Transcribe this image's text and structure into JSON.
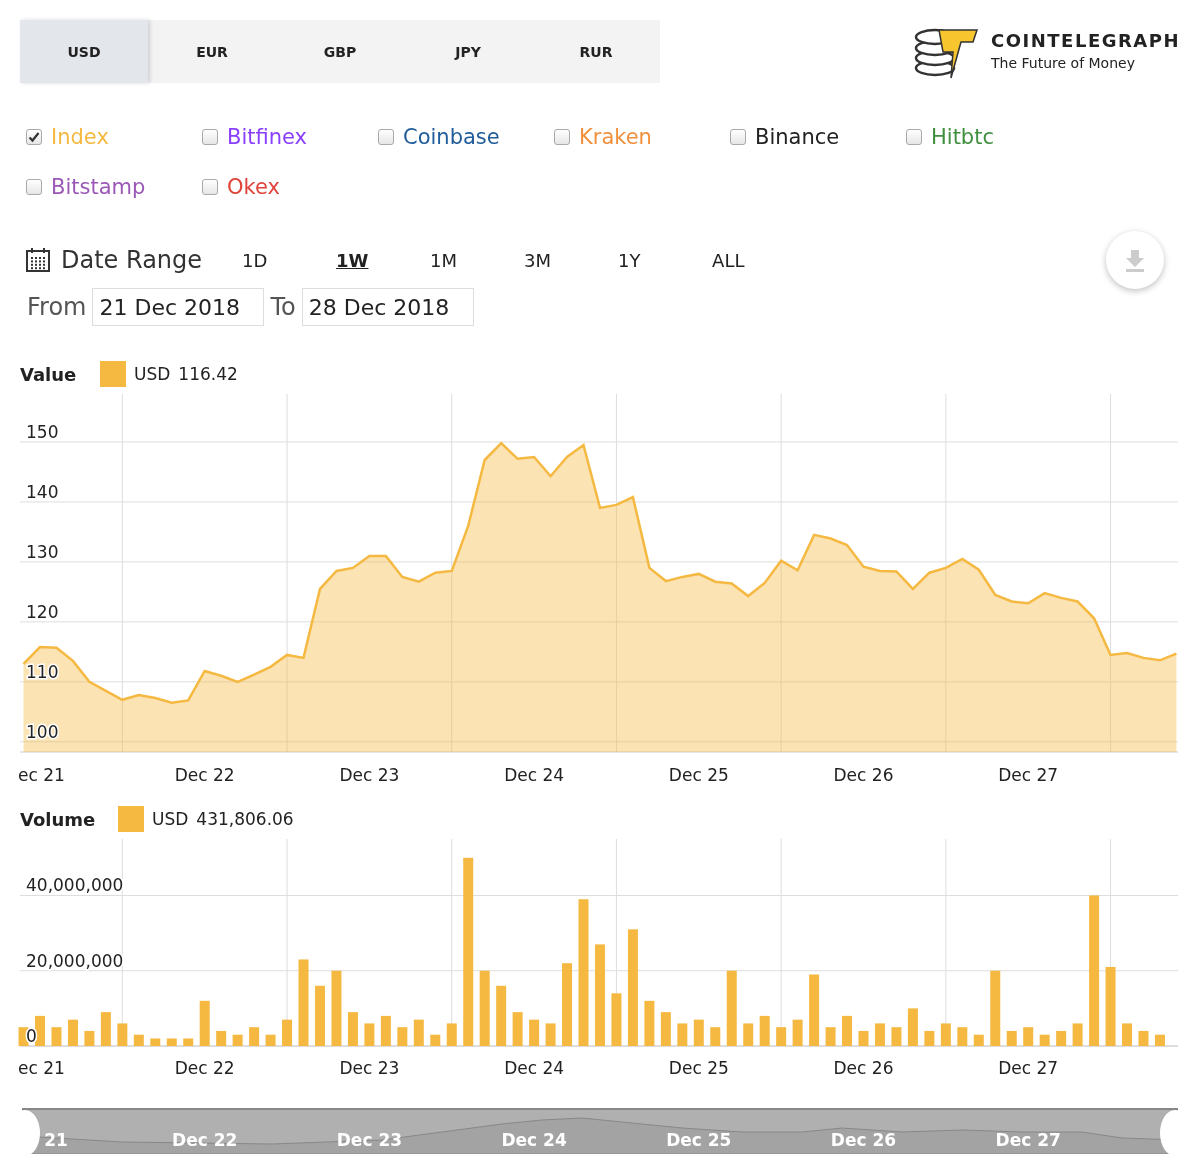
{
  "currency_tabs": [
    {
      "label": "USD",
      "selected": true
    },
    {
      "label": "EUR",
      "selected": false
    },
    {
      "label": "GBP",
      "selected": false
    },
    {
      "label": "JPY",
      "selected": false
    },
    {
      "label": "RUR",
      "selected": false
    }
  ],
  "logo": {
    "name": "COINTELEGRAPH",
    "tagline": "The Future of Money"
  },
  "exchanges": [
    {
      "label": "Index",
      "checked": true,
      "color": "#f5b942"
    },
    {
      "label": "Bitfinex",
      "checked": false,
      "color": "#8a3ffc"
    },
    {
      "label": "Coinbase",
      "checked": false,
      "color": "#1f5c99"
    },
    {
      "label": "Kraken",
      "checked": false,
      "color": "#f0903c"
    },
    {
      "label": "Binance",
      "checked": false,
      "color": "#222222"
    },
    {
      "label": "Hitbtc",
      "checked": false,
      "color": "#3f8f3f"
    },
    {
      "label": "Bitstamp",
      "checked": false,
      "color": "#9b59b6"
    },
    {
      "label": "Okex",
      "checked": false,
      "color": "#e0433a"
    }
  ],
  "date_range": {
    "label": "Date Range",
    "options": [
      {
        "label": "1D",
        "selected": false
      },
      {
        "label": "1W",
        "selected": true
      },
      {
        "label": "1M",
        "selected": false
      },
      {
        "label": "3M",
        "selected": false
      },
      {
        "label": "1Y",
        "selected": false
      },
      {
        "label": "ALL",
        "selected": false
      }
    ],
    "from_label": "From",
    "from": "21 Dec 2018",
    "to_label": "To",
    "to": "28 Dec 2018"
  },
  "value_chart": {
    "title": "Value",
    "legend": {
      "currency": "USD",
      "reading": "116.42"
    },
    "chart_data": {
      "type": "area",
      "grid": true,
      "ylim": [
        98.3,
        158
      ],
      "yticks": [
        100,
        110,
        120,
        130,
        140,
        150
      ],
      "categories": [
        null,
        "ec 21",
        null,
        null,
        null,
        null,
        null,
        null,
        null,
        null,
        null,
        "Dec 22",
        null,
        null,
        null,
        null,
        null,
        null,
        null,
        null,
        null,
        "Dec 23",
        null,
        null,
        null,
        null,
        null,
        null,
        null,
        null,
        null,
        "Dec 24",
        null,
        null,
        null,
        null,
        null,
        null,
        null,
        null,
        null,
        "Dec 25",
        null,
        null,
        null,
        null,
        null,
        null,
        null,
        null,
        null,
        "Dec 26",
        null,
        null,
        null,
        null,
        null,
        null,
        null,
        null,
        null,
        "Dec 27",
        null,
        null,
        null,
        null,
        null,
        null,
        null,
        null,
        null
      ],
      "series": [
        {
          "color": "#f5b942",
          "values": [
            113,
            115.8,
            115.7,
            113.5,
            110,
            108.5,
            107,
            107.8,
            107.3,
            106.5,
            106.9,
            111.8,
            111,
            110,
            111.2,
            112.5,
            114.5,
            114,
            125.5,
            128.5,
            129,
            131,
            131,
            127.5,
            126.7,
            128.2,
            128.5,
            136,
            147,
            149.8,
            147.2,
            147.5,
            144.3,
            147.5,
            149.5,
            139,
            139.5,
            140.8,
            129,
            126.8,
            127.5,
            128,
            126.7,
            126.4,
            124.3,
            126.5,
            130.2,
            128.6,
            134.5,
            133.9,
            132.8,
            129.2,
            128.5,
            128.4,
            125.5,
            128.2,
            129,
            130.5,
            128.7,
            124.5,
            123.4,
            123.1,
            124.8,
            124,
            123.4,
            120.6,
            114.5,
            114.8,
            114,
            113.6,
            114.7
          ]
        }
      ]
    }
  },
  "volume_chart": {
    "title": "Volume",
    "legend": {
      "currency": "USD",
      "reading": "431,806.06"
    },
    "chart_data": {
      "type": "bar",
      "grid": true,
      "ylim": [
        0,
        55000000
      ],
      "yticks": [
        {
          "value": 0,
          "label": "0"
        },
        {
          "value": 20000000,
          "label": "20,000,000"
        },
        {
          "value": 40000000,
          "label": "40,000,000"
        }
      ],
      "categories": [
        null,
        "ec 21",
        null,
        null,
        null,
        null,
        null,
        null,
        null,
        null,
        null,
        "Dec 22",
        null,
        null,
        null,
        null,
        null,
        null,
        null,
        null,
        null,
        "Dec 23",
        null,
        null,
        null,
        null,
        null,
        null,
        null,
        null,
        null,
        "Dec 24",
        null,
        null,
        null,
        null,
        null,
        null,
        null,
        null,
        null,
        "Dec 25",
        null,
        null,
        null,
        null,
        null,
        null,
        null,
        null,
        null,
        "Dec 26",
        null,
        null,
        null,
        null,
        null,
        null,
        null,
        null,
        null,
        "Dec 27",
        null,
        null,
        null,
        null,
        null,
        null,
        null,
        null
      ],
      "series": [
        {
          "color": "#f5b942",
          "values": [
            5000000,
            8000000,
            5000000,
            7000000,
            4000000,
            9000000,
            6000000,
            3000000,
            2000000,
            2000000,
            2000000,
            12000000,
            4000000,
            3000000,
            5000000,
            3000000,
            7000000,
            23000000,
            16000000,
            20000000,
            9000000,
            6000000,
            8000000,
            5000000,
            7000000,
            3000000,
            6000000,
            50000000,
            20000000,
            16000000,
            9000000,
            7000000,
            6000000,
            22000000,
            39000000,
            27000000,
            14000000,
            31000000,
            12000000,
            9000000,
            6000000,
            7000000,
            5000000,
            20000000,
            6000000,
            8000000,
            5000000,
            7000000,
            19000000,
            5000000,
            8000000,
            4000000,
            6000000,
            5000000,
            10000000,
            4000000,
            6000000,
            5000000,
            3000000,
            20000000,
            4000000,
            5000000,
            3000000,
            4000000,
            6000000,
            40000000,
            21000000,
            6000000,
            4000000,
            3000000
          ]
        }
      ]
    }
  },
  "navigator": {
    "labels": [
      "21",
      "Dec 22",
      "Dec 23",
      "Dec 24",
      "Dec 25",
      "Dec 26",
      "Dec 27"
    ]
  }
}
